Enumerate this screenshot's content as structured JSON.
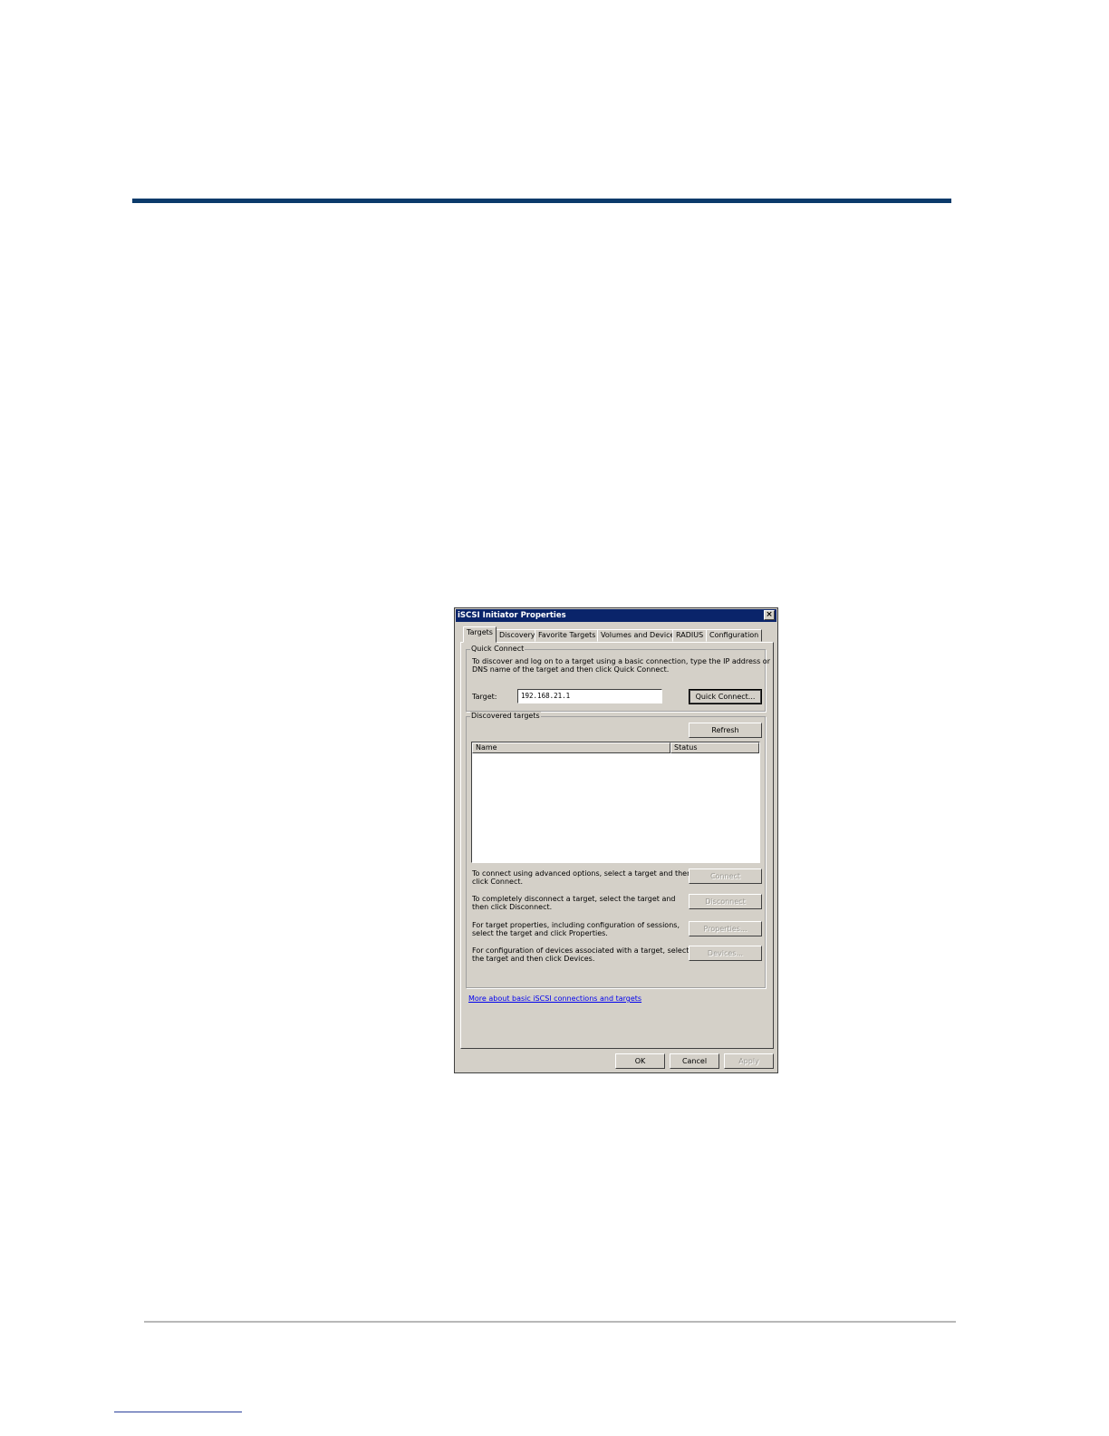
{
  "dialog": {
    "title": "iSCSI Initiator Properties",
    "close_label": "×",
    "tabs": [
      {
        "label": "Targets"
      },
      {
        "label": "Discovery"
      },
      {
        "label": "Favorite Targets"
      },
      {
        "label": "Volumes and Devices"
      },
      {
        "label": "RADIUS"
      },
      {
        "label": "Configuration"
      }
    ],
    "quick_connect": {
      "group_label": "Quick Connect",
      "description_line1": "To discover and log on to a target using a basic connection, type the IP address or",
      "description_line2": "DNS name of the target and then click Quick Connect.",
      "target_label": "Target:",
      "target_value": "192.168.21.1",
      "button_label": "Quick Connect..."
    },
    "discovered_targets": {
      "group_label": "Discovered targets",
      "refresh_label": "Refresh",
      "columns": [
        "Name",
        "Status"
      ],
      "rows": []
    },
    "actions": [
      {
        "line1": "To connect using advanced options, select a target and then",
        "line2": "click Connect.",
        "button": "Connect"
      },
      {
        "line1": "To completely disconnect a target, select the target and",
        "line2": "then click Disconnect.",
        "button": "Disconnect"
      },
      {
        "line1": "For target properties, including configuration of sessions,",
        "line2": "select the target and click Properties.",
        "button": "Properties..."
      },
      {
        "line1": "For configuration of devices associated with a target, select",
        "line2": "the target and then click Devices.",
        "button": "Devices..."
      }
    ],
    "help_link": "More about basic iSCSI connections and targets",
    "footer_buttons": {
      "ok": "OK",
      "cancel": "Cancel",
      "apply": "Apply"
    }
  }
}
